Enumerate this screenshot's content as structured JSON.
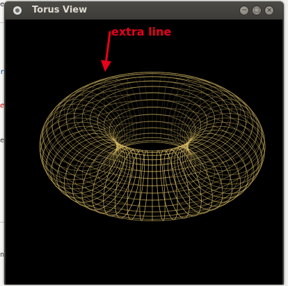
{
  "window": {
    "title": "Torus View",
    "buttons": {
      "minimize": "−",
      "maximize": "□",
      "close": "×"
    }
  },
  "background_fragments": [
    "ee",
    "r",
    "er",
    "e",
    "n"
  ],
  "annotation": {
    "text": "extra line",
    "color": "#e8001c"
  },
  "torus": {
    "wire_color": "#e2c46a",
    "style": "wireframe"
  }
}
